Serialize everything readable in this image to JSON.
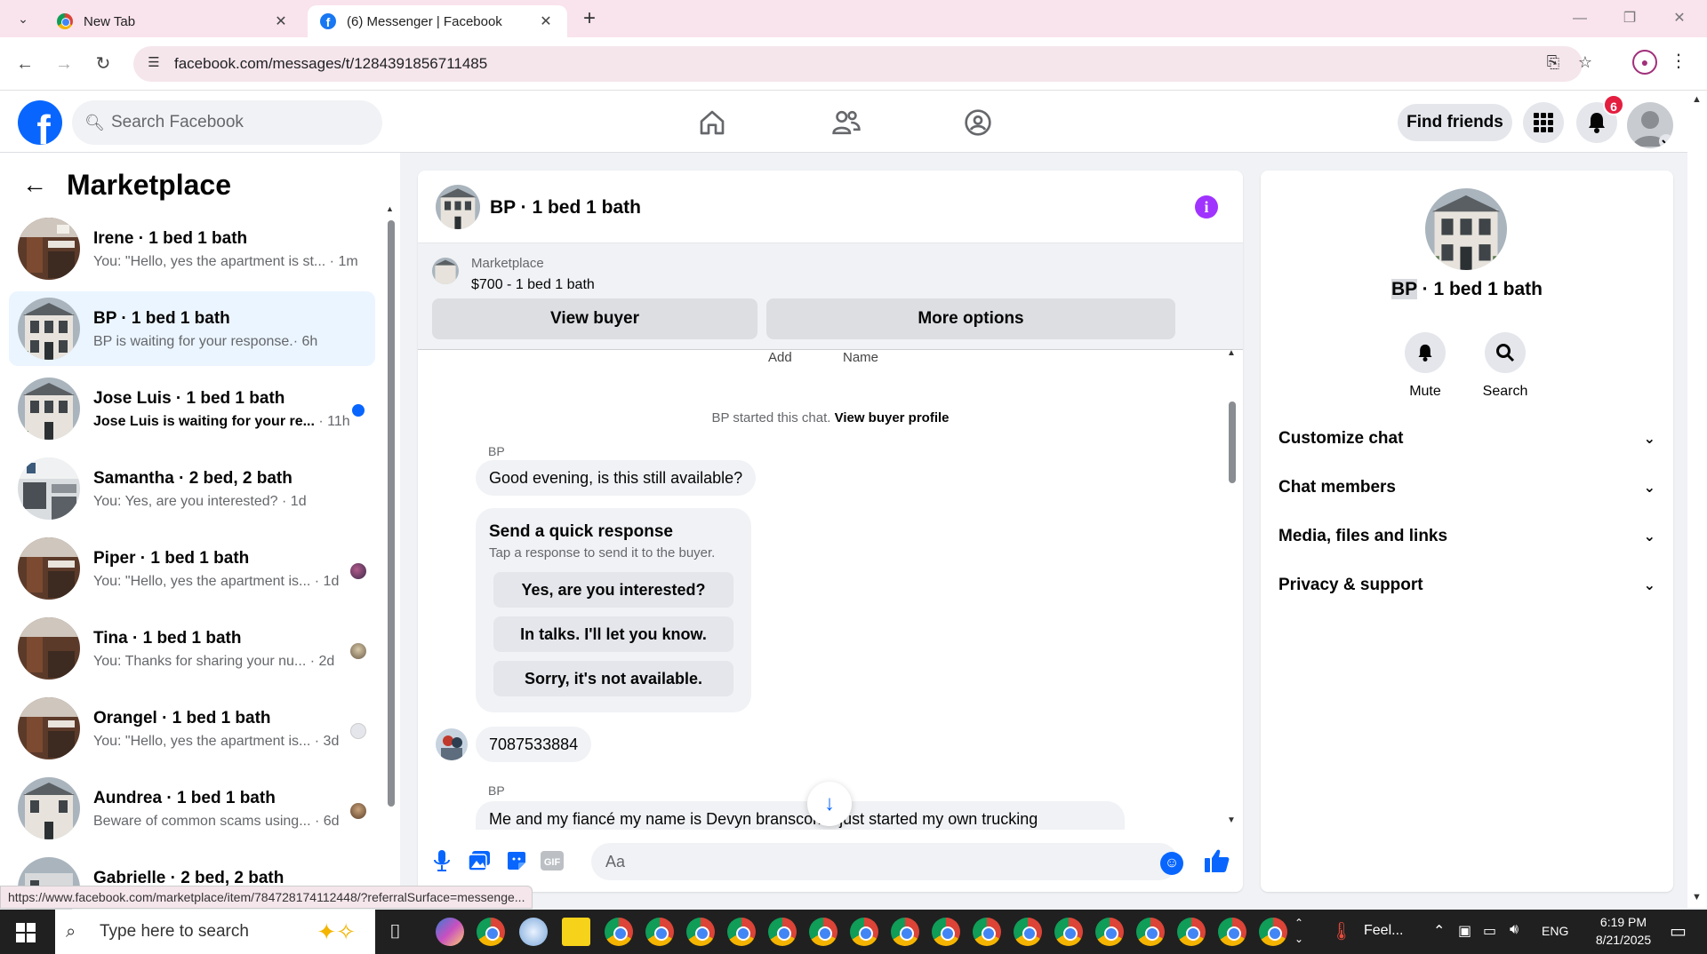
{
  "browser": {
    "tabs": [
      {
        "title": "New Tab"
      },
      {
        "title": "(6) Messenger | Facebook"
      }
    ],
    "url": "facebook.com/messages/t/1284391856711485",
    "status_url": "https://www.facebook.com/marketplace/item/784728174112448/?referralSurface=messenge..."
  },
  "fb_header": {
    "search_placeholder": "Search Facebook",
    "find_friends": "Find friends",
    "notification_count": "6"
  },
  "left": {
    "title": "Marketplace",
    "conversations": [
      {
        "title": "Irene · 1 bed 1 bath",
        "preview": "You: \"Hello, yes the apartment is st...",
        "time": "· 1m"
      },
      {
        "title": "BP · 1 bed 1 bath",
        "preview": "BP is waiting for your response.",
        "time": "· 6h"
      },
      {
        "title": "Jose Luis · 1 bed 1 bath",
        "preview": "Jose Luis is waiting for your re...",
        "time": "· 11h"
      },
      {
        "title": "Samantha · 2 bed, 2 bath",
        "preview": "You: Yes, are you interested?",
        "time": "· 1d"
      },
      {
        "title": "Piper · 1 bed 1 bath",
        "preview": "You: \"Hello, yes the apartment is...",
        "time": "· 1d"
      },
      {
        "title": "Tina · 1 bed 1 bath",
        "preview": "You: Thanks for sharing your nu...",
        "time": "· 2d"
      },
      {
        "title": "Orangel · 1 bed 1 bath",
        "preview": "You: \"Hello, yes the apartment is...",
        "time": "· 3d"
      },
      {
        "title": "Aundrea · 1 bed 1 bath",
        "preview": "Beware of common scams using...",
        "time": "· 6d"
      },
      {
        "title": "Gabrielle · 2 bed, 2 bath",
        "preview": "",
        "time": ""
      }
    ]
  },
  "chat": {
    "title": "BP · 1 bed 1 bath",
    "marketplace_label": "Marketplace",
    "listing": "$700 - 1 bed 1 bath",
    "view_buyer": "View buyer",
    "more_options": "More options",
    "cut_left": "Add",
    "cut_right": "Name",
    "system_note": "BP started this chat.",
    "system_link": "View buyer profile",
    "sender_1": "BP",
    "msg_1": "Good evening, is this still available?",
    "qr_title": "Send a quick response",
    "qr_sub": "Tap a response to send it to the buyer.",
    "qr_options": [
      "Yes, are you interested?",
      "In talks. I'll let you know.",
      "Sorry, it's not available."
    ],
    "msg_2": "7087533884",
    "sender_2": "BP",
    "msg_3": "Me and my fiancé my name is Devyn branscomb just started my own trucking",
    "composer_placeholder": "Aa"
  },
  "details": {
    "title_highlight": "BP",
    "title_rest": " · 1 bed 1 bath",
    "mute": "Mute",
    "search": "Search",
    "sections": [
      "Customize chat",
      "Chat members",
      "Media, files and links",
      "Privacy & support"
    ]
  },
  "taskbar": {
    "search_placeholder": "Type here to search",
    "weather": "Feel...",
    "lang": "ENG",
    "time": "6:19 PM",
    "date": "8/21/2025"
  },
  "colors": {
    "fb_blue": "#0866ff",
    "selected_row": "#ebf5ff",
    "info_purple": "#a033ff",
    "badge_red": "#e41e3f",
    "chrome_tab_bg": "#f9e3ec"
  }
}
